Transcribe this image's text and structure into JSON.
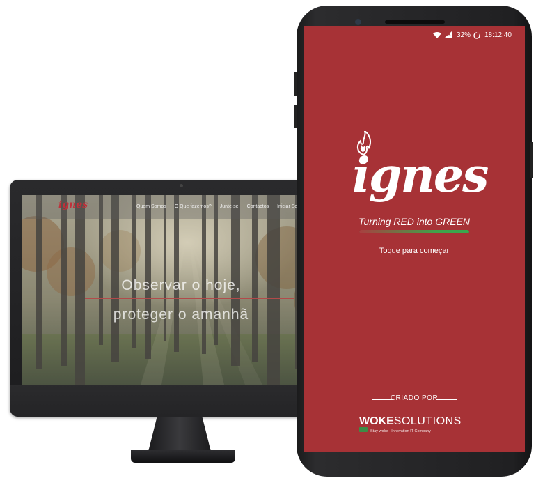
{
  "website": {
    "logo": "ignes",
    "nav": [
      "Quem Somos",
      "O Que fazemos?",
      "Junte-se",
      "Contactos",
      "Iniciar Sessão"
    ],
    "hero": {
      "line1": "Observar o hoje,",
      "line2": "proteger o amanhã"
    }
  },
  "phone": {
    "status": {
      "battery": "32%",
      "time": "18:12:40"
    },
    "logo": "ignes",
    "tagline": "Turning RED into GREEN",
    "start_hint": "Toque para começar",
    "credit_label": "CRIADO POR",
    "brand": {
      "part1": "WOKE",
      "part2": "SOLUTIONS",
      "sub": "Stay woke - Innovation IT Company"
    },
    "progress": 1.0
  },
  "colors": {
    "app_red": "#a73236",
    "progress_green": "#3fa34a",
    "logo_red": "#c0303a"
  }
}
